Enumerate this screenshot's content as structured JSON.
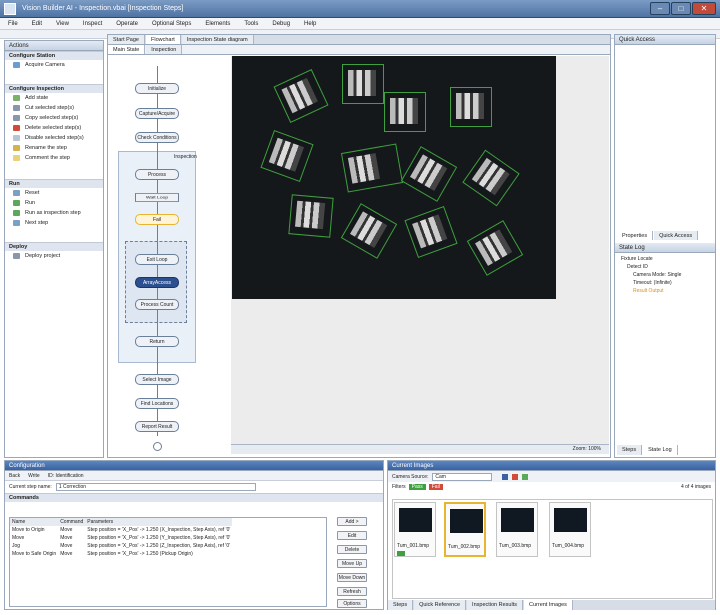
{
  "window": {
    "title": "Vision Builder AI - Inspection.vbai [Inspection Steps]"
  },
  "menu": [
    "File",
    "Edit",
    "View",
    "Inspect",
    "Operate",
    "Optional Steps",
    "Elements",
    "Tools",
    "Debug",
    "Help"
  ],
  "left": {
    "header": "Actions",
    "sections": [
      {
        "title": "Configure Station",
        "items": [
          "Acquire Camera"
        ]
      },
      {
        "title": "Configure Inspection",
        "items": [
          "Add state",
          "Cut selected step(s)",
          "Copy selected step(s)",
          "Delete selected step(s)",
          "Disable selected step(s)",
          "Rename the step",
          "Comment the step"
        ]
      },
      {
        "title": "Run",
        "items": [
          "Reset",
          "Run",
          "Run as inspection step",
          "Next step"
        ]
      },
      {
        "title": "Deploy",
        "items": [
          "Deploy project"
        ]
      }
    ]
  },
  "editor_tabs": [
    "Start Page",
    "Flowchart",
    "Inspection State diagram"
  ],
  "diagram": {
    "tabs": [
      "Main State",
      "Inspection"
    ],
    "label": "Inspection",
    "nodes": [
      "Initialize",
      "Capture/Acquire",
      "Check Conditions",
      "Process",
      "Wait Loop",
      "Fail",
      "Exit Loop",
      "ArrayAccess",
      "Process Count",
      "Return",
      "Select Image",
      "Find Locations",
      "Report Result"
    ]
  },
  "image_view": {
    "status": "Zoom: 100%"
  },
  "right": {
    "header": "Quick Access",
    "tabs": [
      "Properties",
      "Quick Access"
    ],
    "log_header": "State Log",
    "log_items": [
      "Fixture Locate",
      "Detect ID",
      "Camera Mode: Single",
      "Timeout: (Infinite)",
      "Result Output"
    ],
    "bottom_tabs": [
      "Steps",
      "State Log"
    ]
  },
  "config": {
    "header": "Configuration",
    "toolbar": [
      "Back",
      "Write",
      "ID: Identification"
    ],
    "name_label": "Current step name:",
    "name_value": "1 Correction",
    "section": "Commands",
    "columns": [
      "Name",
      "Command",
      "Parameters"
    ],
    "rows": [
      [
        "Move to Origin",
        "Move",
        "Step position = 'X_Pos' -> 1.250 (X_Inspection, Step Axis), ref '0'"
      ],
      [
        "Move",
        "Move",
        "Step position = 'X_Pos' -> 1.250 (Y_Inspection, Step Axis), ref '0'"
      ],
      [
        "Jog",
        "Move",
        "Step position = 'X_Pos' -> 1.250 (Z_Inspection, Step Axis), ref '0'"
      ],
      [
        "Move to Safe Origin",
        "Move",
        "Step position = 'X_Pos' -> 1.250 (Pickup Origin)"
      ]
    ],
    "buttons": [
      "Add >",
      "Edit",
      "Delete",
      "Move Up",
      "Move Down",
      "Refresh",
      "Options"
    ]
  },
  "images": {
    "header": "Current Images",
    "source_label": "Camera Source:",
    "source_value": "Cam",
    "filter_label": "Filters",
    "badges": [
      "Pass",
      "Fail"
    ],
    "count": "4 of 4 images",
    "thumbs": [
      "Tum_001.bmp",
      "Tum_002.bmp",
      "Tum_003.bmp",
      "Tum_004.bmp"
    ],
    "status_tabs": [
      "Steps",
      "Quick Reference",
      "Inspection Results",
      "Current Images"
    ]
  },
  "colors": {
    "titlebar": "#4f73a3",
    "inspect_box": "#3ea03e",
    "selected_node": "#2b4f8f",
    "highlight": "#e7b531"
  }
}
